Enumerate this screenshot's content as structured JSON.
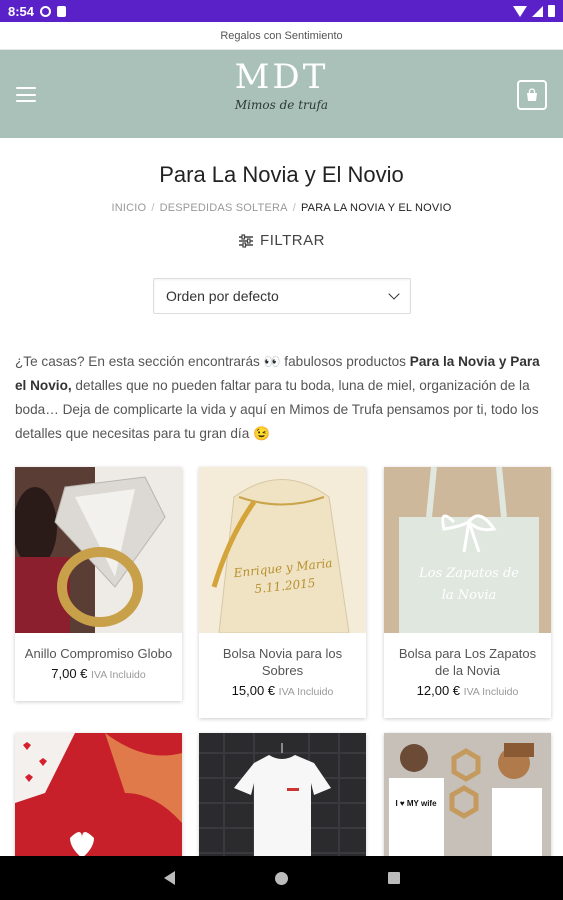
{
  "status_bar": {
    "time": "8:54"
  },
  "topbar": {
    "tagline": "Regalos con Sentimiento"
  },
  "header": {
    "logo_text": "MDT",
    "logo_script": "Mimos de trufa"
  },
  "page": {
    "title": "Para La Novia y El Novio",
    "breadcrumb": [
      "INICIO",
      "DESPEDIDAS SOLTERA",
      "PARA LA NOVIA Y EL NOVIO"
    ],
    "filter_label": "FILTRAR",
    "sort_value": "Orden por defecto"
  },
  "description": {
    "part1": "¿Te casas? En esta sección encontrarás 👀 fabulosos productos ",
    "bold": "Para la Novia y Para el Novio,",
    "part2": " detalles que no pueden faltar para tu boda, luna de miel, organización de la boda… Deja de complicarte la vida y aquí en Mimos de Trufa pensamos por ti, todo los detalles que necesitas para tu gran día 😉"
  },
  "products": [
    {
      "name": "Anillo Compromiso Globo",
      "price": "7,00 €",
      "iva": "IVA Incluido",
      "image_text": ""
    },
    {
      "name": "Bolsa Novia para los Sobres",
      "price": "15,00 €",
      "iva": "IVA Incluido",
      "image_text": "Enrique y Maria 5.11.2015"
    },
    {
      "name": "Bolsa para Los Zapatos de la Novia",
      "price": "12,00 €",
      "iva": "IVA Incluido",
      "image_text": "Los Zapatos de la Novia"
    },
    {
      "name": "",
      "price": "",
      "iva": "",
      "image_text": ""
    },
    {
      "name": "",
      "price": "",
      "iva": "",
      "image_text": ""
    },
    {
      "name": "",
      "price": "",
      "iva": "",
      "image_text": "I ♥ MY wife"
    }
  ],
  "colors": {
    "status_bar": "#5b21c9",
    "header": "#a9c1b8",
    "accent": "#222222"
  }
}
